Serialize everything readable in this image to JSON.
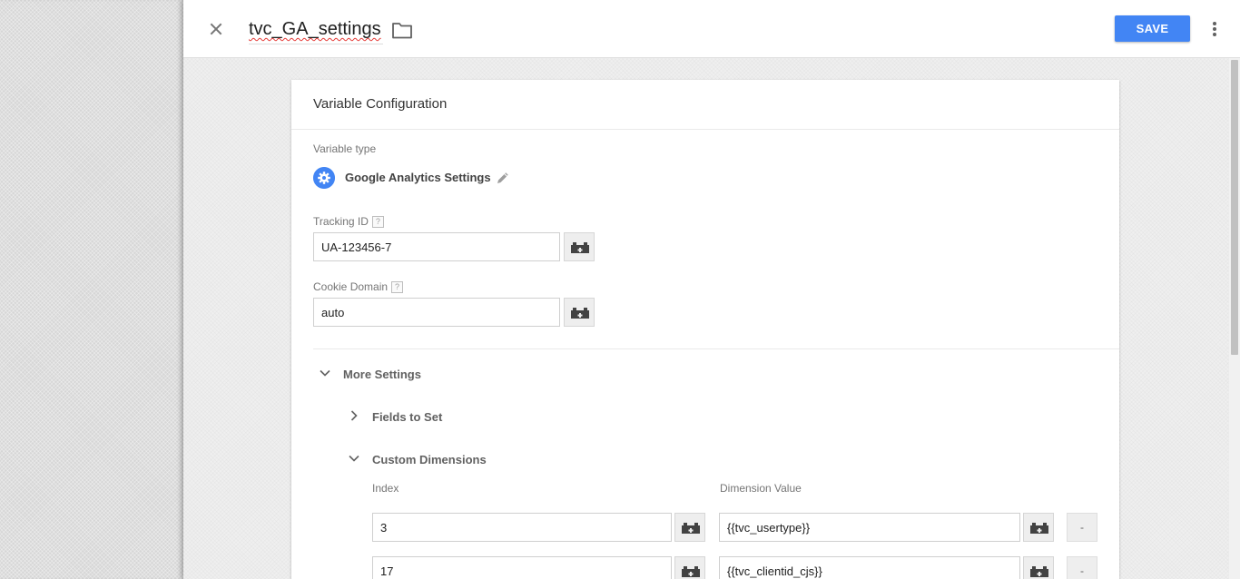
{
  "header": {
    "title": "tvc_GA_settings",
    "save_label": "SAVE"
  },
  "card": {
    "title": "Variable Configuration",
    "variable_type_label": "Variable type",
    "variable_type_name": "Google Analytics Settings",
    "tracking_id": {
      "label": "Tracking ID",
      "help": "?",
      "value": "UA-123456-7"
    },
    "cookie_domain": {
      "label": "Cookie Domain",
      "help": "?",
      "value": "auto"
    },
    "more_settings_label": "More Settings",
    "fields_to_set_label": "Fields to Set",
    "custom_dimensions": {
      "label": "Custom Dimensions",
      "index_header": "Index",
      "value_header": "Dimension Value",
      "rows": [
        {
          "index": "3",
          "value": "{{tvc_usertype}}",
          "remove_label": "-"
        },
        {
          "index": "17",
          "value": "{{tvc_clientid_cjs}}",
          "remove_label": "-"
        }
      ]
    }
  },
  "colors": {
    "accent": "#4285f4",
    "spellcheck": "#e53935"
  },
  "icons": [
    "close-icon",
    "folder-icon",
    "more-vert-icon",
    "gear-icon",
    "pencil-icon",
    "variable-brick-icon",
    "chevron-down-icon",
    "chevron-right-icon"
  ]
}
